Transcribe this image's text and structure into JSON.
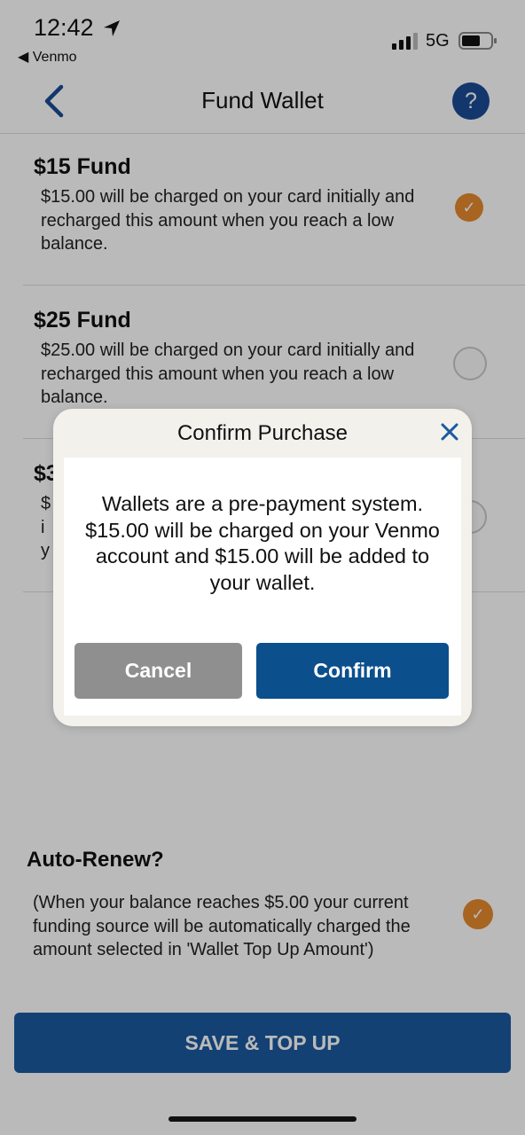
{
  "status_bar": {
    "time": "12:42",
    "back_app": "◀ Venmo",
    "network": "5G"
  },
  "nav": {
    "title": "Fund Wallet",
    "help_label": "?"
  },
  "funds": [
    {
      "title": "$15 Fund",
      "description": "$15.00 will be charged on your card initially and recharged this amount when you reach a low balance.",
      "selected": true
    },
    {
      "title": "$25 Fund",
      "description": "$25.00 will be charged on your card initially and recharged this amount when you reach a low balance.",
      "selected": false
    },
    {
      "title": "$3",
      "description": "$\ni\ny",
      "selected": false
    }
  ],
  "auto_renew": {
    "title": "Auto-Renew?",
    "description": "(When your balance reaches $5.00 your current funding source will be automatically charged the amount selected in 'Wallet Top Up Amount')",
    "checked": true
  },
  "save_button": "SAVE & TOP UP",
  "modal": {
    "title": "Confirm Purchase",
    "message": "Wallets are a pre-payment system. $15.00 will be charged on your Venmo account and $15.00 will be added to your wallet.",
    "cancel_label": "Cancel",
    "confirm_label": "Confirm"
  },
  "colors": {
    "accent_orange": "#e68a2e",
    "brand_blue": "#0b4f8c",
    "help_blue": "#1b4a96"
  }
}
